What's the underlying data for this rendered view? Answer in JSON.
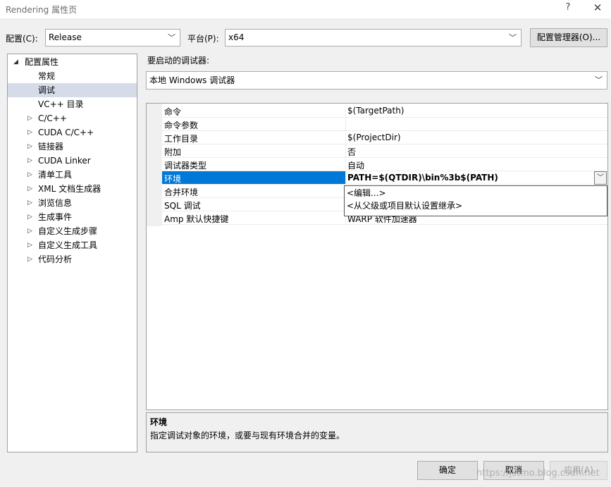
{
  "window": {
    "title": "Rendering 属性页",
    "help_glyph": "?",
    "close_glyph": "✕"
  },
  "toolbar": {
    "config_label": "配置(C):",
    "config_value": "Release",
    "platform_label": "平台(P):",
    "platform_value": "x64",
    "config_manager_button": "配置管理器(O)..."
  },
  "tree": {
    "root": "配置属性",
    "items": [
      {
        "label": "常规",
        "expandable": false,
        "selected": false
      },
      {
        "label": "调试",
        "expandable": false,
        "selected": true
      },
      {
        "label": "VC++ 目录",
        "expandable": false,
        "selected": false
      },
      {
        "label": "C/C++",
        "expandable": true,
        "selected": false
      },
      {
        "label": "CUDA C/C++",
        "expandable": true,
        "selected": false
      },
      {
        "label": "链接器",
        "expandable": true,
        "selected": false
      },
      {
        "label": "CUDA Linker",
        "expandable": true,
        "selected": false
      },
      {
        "label": "清单工具",
        "expandable": true,
        "selected": false
      },
      {
        "label": "XML 文档生成器",
        "expandable": true,
        "selected": false
      },
      {
        "label": "浏览信息",
        "expandable": true,
        "selected": false
      },
      {
        "label": "生成事件",
        "expandable": true,
        "selected": false
      },
      {
        "label": "自定义生成步骤",
        "expandable": true,
        "selected": false
      },
      {
        "label": "自定义生成工具",
        "expandable": true,
        "selected": false
      },
      {
        "label": "代码分析",
        "expandable": true,
        "selected": false
      }
    ]
  },
  "debugger": {
    "label": "要启动的调试器:",
    "value": "本地 Windows 调试器"
  },
  "properties": [
    {
      "name": "命令",
      "value": "$(TargetPath)"
    },
    {
      "name": "命令参数",
      "value": ""
    },
    {
      "name": "工作目录",
      "value": "$(ProjectDir)"
    },
    {
      "name": "附加",
      "value": "否"
    },
    {
      "name": "调试器类型",
      "value": "自动"
    },
    {
      "name": "环境",
      "value": "PATH=$(QTDIR)\\bin%3b$(PATH)",
      "selected": true
    },
    {
      "name": "合并环境",
      "value": ""
    },
    {
      "name": "SQL 调试",
      "value": ""
    },
    {
      "name": "Amp 默认快捷键",
      "value": "WARP 软件加速器"
    }
  ],
  "env_dropdown": {
    "options": [
      "<编辑...>",
      "<从父级或项目默认设置继承>"
    ]
  },
  "description": {
    "title": "环境",
    "text": "指定调试对象的环境，或要与现有环境合并的变量。"
  },
  "buttons": {
    "ok": "确定",
    "cancel": "取消",
    "apply": "应用(A)"
  },
  "watermark": "https://jstmo.blog.csdn.net"
}
